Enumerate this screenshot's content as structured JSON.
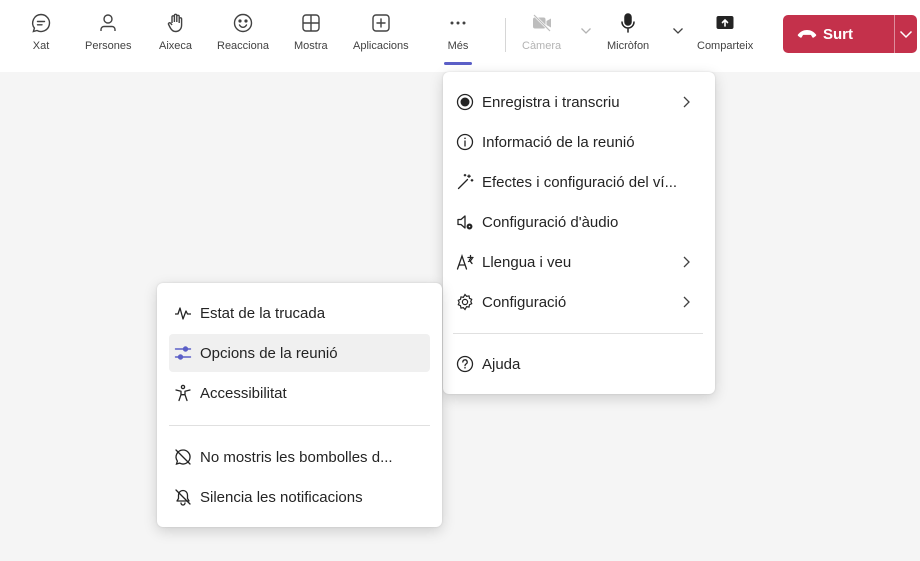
{
  "toolbar": {
    "chat": "Xat",
    "people": "Persones",
    "raise": "Aixeca",
    "react": "Reacciona",
    "view": "Mostra",
    "apps": "Aplicacions",
    "more": "Més",
    "camera": "Càmera",
    "mic": "Micròfon",
    "share": "Comparteix",
    "leave": "Surt"
  },
  "more_menu": {
    "items": [
      {
        "label": "Enregistra i transcriu",
        "icon": "record-icon",
        "submenu": true
      },
      {
        "label": "Informació de la reunió",
        "icon": "info-icon",
        "submenu": false
      },
      {
        "label": "Efectes i configuració del ví...",
        "icon": "magic-wand-icon",
        "submenu": false
      },
      {
        "label": "Configuració d'àudio",
        "icon": "speaker-settings-icon",
        "submenu": false
      },
      {
        "label": "Llengua i veu",
        "icon": "language-icon",
        "submenu": true
      },
      {
        "label": "Configuració",
        "icon": "gear-icon",
        "submenu": true
      }
    ],
    "help": "Ajuda"
  },
  "settings_submenu": {
    "items": [
      {
        "label": "Estat de la trucada",
        "icon": "pulse-icon"
      },
      {
        "label": "Opcions de la reunió",
        "icon": "sliders-icon",
        "highlighted": true
      },
      {
        "label": "Accessibilitat",
        "icon": "accessibility-icon"
      }
    ],
    "items2": [
      {
        "label": "No mostris les bombolles d...",
        "icon": "chat-off-icon"
      },
      {
        "label": "Silencia les notificacions",
        "icon": "bell-off-icon"
      }
    ]
  },
  "colors": {
    "accent": "#5b5fc7",
    "leave": "#c4314b"
  }
}
